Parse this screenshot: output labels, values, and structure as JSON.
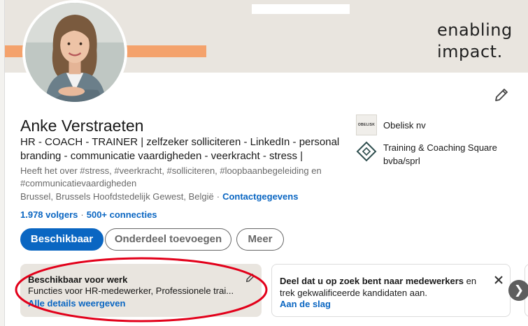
{
  "banner": {
    "slogan_line1": "enabling",
    "slogan_line2": "impact.",
    "stripe_color": "#f4a26c"
  },
  "profile": {
    "name": "Anke Verstraeten",
    "headline": "HR - COACH - TRAINER | zelfzeker solliciteren - LinkedIn - personal branding - communicatie vaardigheden - veerkracht - stress |",
    "topics": "Heeft het over #stress, #veerkracht, #solliciteren, #loopbaanbegeleiding en #communicatievaardigheden",
    "location": "Brussel, Brussels Hoofdstedelijk Gewest, België",
    "location_separator": "·",
    "contact_link": "Contactgegevens",
    "followers": "1.978 volgers",
    "counts_separator": "·",
    "connections": "500+ connecties",
    "edit_icon": "pencil-icon"
  },
  "actions": {
    "primary": "Beschikbaar",
    "add_section": "Onderdeel toevoegen",
    "more": "Meer",
    "accent": "#0a66c2"
  },
  "companies": [
    {
      "name": "Obelisk nv",
      "logo_text": "OBELISK",
      "icon": "obelisk-logo"
    },
    {
      "name": "Training & Coaching Square bvba/sprl",
      "icon": "square-logo"
    }
  ],
  "open_to_work": {
    "title": "Beschikbaar voor werk",
    "text": "Functies voor HR-medewerker, Professionele trai...",
    "link": "Alle details weergeven",
    "edit_icon": "pencil-icon"
  },
  "share_card": {
    "title_bold": "Deel dat u op zoek bent naar medewerkers",
    "title_rest": " en trek gekwalificeerde kandidaten aan.",
    "link": "Aan de slag",
    "close_icon": "close-icon"
  },
  "carousel": {
    "next_glyph": "❯",
    "next_icon": "chevron-right-icon"
  },
  "annotation_color": "#e2001a"
}
